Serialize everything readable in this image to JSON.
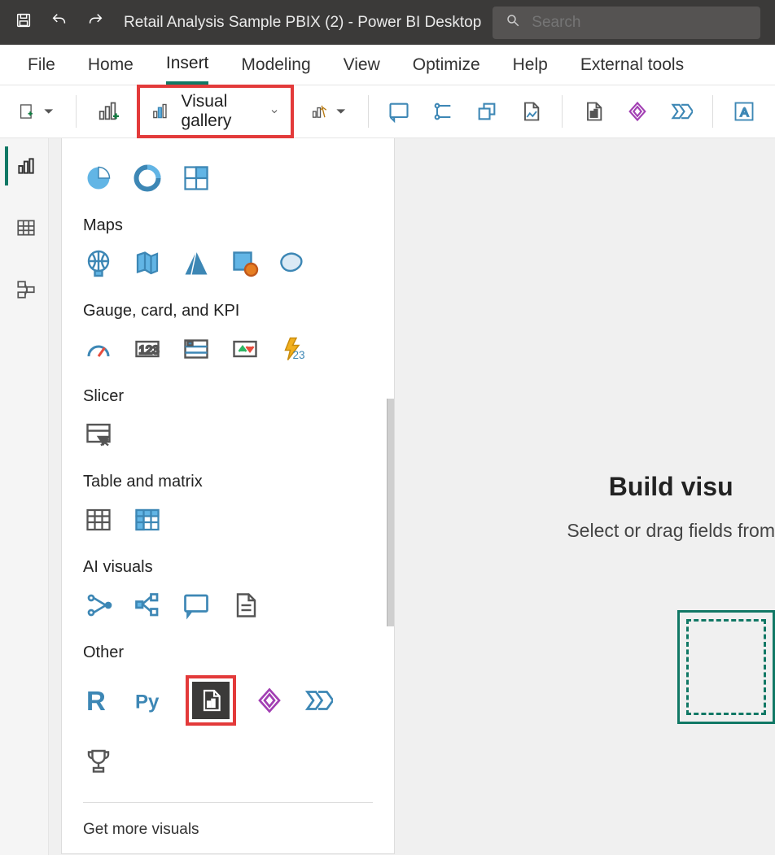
{
  "title_bar": {
    "file_title": "Retail Analysis Sample PBIX (2) - Power BI Desktop",
    "search_placeholder": "Search"
  },
  "tabs": {
    "items": [
      "File",
      "Home",
      "Insert",
      "Modeling",
      "View",
      "Optimize",
      "Help",
      "External tools"
    ],
    "active": "Insert"
  },
  "ribbon": {
    "visual_gallery_label": "Visual gallery"
  },
  "gallery": {
    "section_maps": "Maps",
    "section_gauge": "Gauge, card, and KPI",
    "section_slicer": "Slicer",
    "section_table": "Table and matrix",
    "section_ai": "AI visuals",
    "section_other": "Other",
    "footer_get_more": "Get more visuals"
  },
  "canvas": {
    "build_heading": "Build visu",
    "build_sub": "Select or drag fields from "
  }
}
